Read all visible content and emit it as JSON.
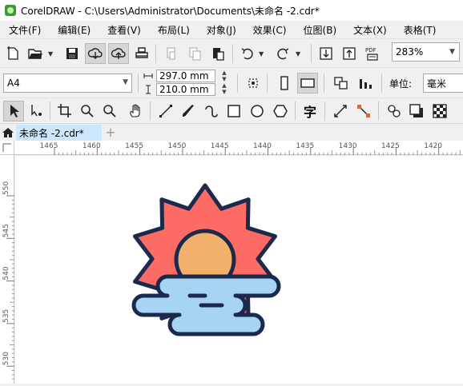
{
  "window": {
    "title": "CorelDRAW - C:\\Users\\Administrator\\Documents\\未命名 -2.cdr*"
  },
  "menu": [
    {
      "label": "文件(F)"
    },
    {
      "label": "编辑(E)"
    },
    {
      "label": "查看(V)"
    },
    {
      "label": "布局(L)"
    },
    {
      "label": "对象(J)"
    },
    {
      "label": "效果(C)"
    },
    {
      "label": "位图(B)"
    },
    {
      "label": "文本(X)"
    },
    {
      "label": "表格(T)"
    }
  ],
  "standard_toolbar": {
    "zoom": "283%"
  },
  "property_bar": {
    "page_size": "A4",
    "width": "297.0 mm",
    "height": "210.0 mm",
    "unit_label": "单位:",
    "unit_value": "毫米"
  },
  "toolbox": [
    {
      "icon": "pick-tool-icon"
    },
    {
      "icon": "shape-tool-icon"
    },
    {
      "icon": "crop-tool-icon"
    },
    {
      "icon": "zoom-tool-icon"
    },
    {
      "icon": "pan-tool-icon"
    },
    {
      "icon": "freehand-tool-icon"
    },
    {
      "icon": "artistic-media-icon"
    },
    {
      "icon": "rectangle-tool-icon"
    },
    {
      "icon": "ellipse-tool-icon"
    },
    {
      "icon": "polygon-tool-icon"
    },
    {
      "icon": "text-tool-icon",
      "label": "字"
    },
    {
      "icon": "connector-tool-icon"
    },
    {
      "icon": "shadow-tool-icon"
    },
    {
      "icon": "transparency-tool-icon"
    }
  ],
  "document_tab": {
    "label": "未命名 -2.cdr*",
    "add_label": "+"
  },
  "ruler": {
    "horizontal_ticks": [
      "1465",
      "1460",
      "1455",
      "1450",
      "1445",
      "1440",
      "1435",
      "1430",
      "1425",
      "1420"
    ],
    "vertical_ticks": [
      "550",
      "545",
      "540",
      "535",
      "530"
    ]
  },
  "colors": {
    "sun_rays": "#fd6b65",
    "sun_core": "#f3b06a",
    "cloud": "#a6d4f2",
    "outline": "#1b2a4c",
    "tab_active": "#cce6fb"
  }
}
